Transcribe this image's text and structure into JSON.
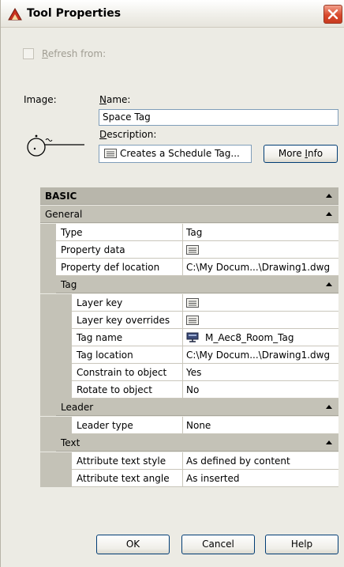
{
  "window": {
    "title": "Tool Properties"
  },
  "refresh": {
    "label_prefix": "R",
    "label_rest": "efresh from:",
    "checked": false
  },
  "image_label": "Image:",
  "name": {
    "label_u": "N",
    "label_rest": "ame:",
    "value": "Space Tag"
  },
  "description": {
    "label_u": "D",
    "label_rest": "escription:",
    "value": "Creates a Schedule Tag..."
  },
  "more_info": {
    "label_pre": "More ",
    "label_u": "I",
    "label_rest": "nfo"
  },
  "grid": {
    "basic": "BASIC",
    "general": "General",
    "type": {
      "name": "Type",
      "value": "Tag"
    },
    "property_data": {
      "name": "Property data"
    },
    "property_def_location": {
      "name": "Property def location",
      "value": "C:\\My Docum...\\Drawing1.dwg"
    },
    "tag_section": "Tag",
    "layer_key": {
      "name": "Layer key"
    },
    "layer_key_overrides": {
      "name": "Layer key overrides"
    },
    "tag_name": {
      "name": "Tag name",
      "value": "M_Aec8_Room_Tag"
    },
    "tag_location": {
      "name": "Tag location",
      "value": "C:\\My Docum...\\Drawing1.dwg"
    },
    "constrain_to_object": {
      "name": "Constrain to object",
      "value": "Yes"
    },
    "rotate_to_object": {
      "name": "Rotate to object",
      "value": "No"
    },
    "leader_section": "Leader",
    "leader_type": {
      "name": "Leader type",
      "value": "None"
    },
    "text_section": "Text",
    "attribute_text_style": {
      "name": "Attribute text style",
      "value": "As defined by content"
    },
    "attribute_text_angle": {
      "name": "Attribute text angle",
      "value": "As inserted"
    }
  },
  "buttons": {
    "ok": "OK",
    "cancel": "Cancel",
    "help": "Help"
  },
  "icons": {
    "title": "autocad-tool-icon",
    "close": "close-icon",
    "detail_edit": "detail-edit-icon",
    "tag_block": "tag-block-icon"
  }
}
